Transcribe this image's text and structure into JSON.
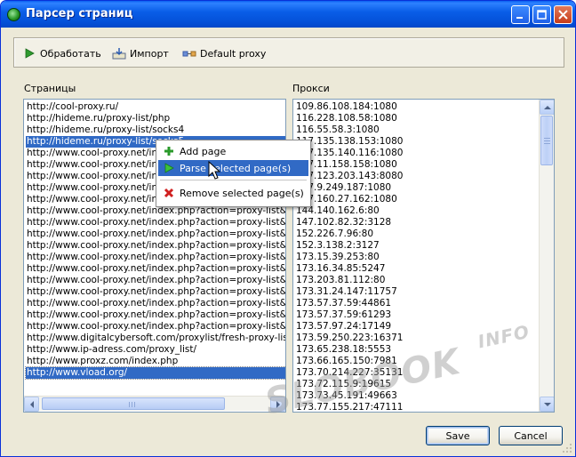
{
  "window": {
    "title": "Парсер страниц"
  },
  "toolbar": {
    "process_label": "Обработать",
    "import_label": "Импорт",
    "proxy_label": "Default proxy"
  },
  "pages": {
    "label": "Страницы",
    "items": [
      "http://cool-proxy.ru/",
      "http://hideme.ru/proxy-list/php",
      "http://hideme.ru/proxy-list/socks4",
      "http://hideme.ru/proxy-list/socks5",
      "http://www.cool-proxy.net/index.php?action=proxy-list&page=1",
      "http://www.cool-proxy.net/index.php?action=proxy-list&page=2",
      "http://www.cool-proxy.net/index.php?action=proxy-list&page=3",
      "http://www.cool-proxy.net/index.php?action=proxy-list&page=4",
      "http://www.cool-proxy.net/index.php?action=proxy-list&page=5",
      "http://www.cool-proxy.net/index.php?action=proxy-list&pa",
      "http://www.cool-proxy.net/index.php?action=proxy-list&pa",
      "http://www.cool-proxy.net/index.php?action=proxy-list&pa",
      "http://www.cool-proxy.net/index.php?action=proxy-list&pa",
      "http://www.cool-proxy.net/index.php?action=proxy-list&pa",
      "http://www.cool-proxy.net/index.php?action=proxy-list&pa",
      "http://www.cool-proxy.net/index.php?action=proxy-list&pa",
      "http://www.cool-proxy.net/index.php?action=proxy-list&pa",
      "http://www.cool-proxy.net/index.php?action=proxy-list&pa",
      "http://www.cool-proxy.net/index.php?action=proxy-list&pa",
      "http://www.cool-proxy.net/index.php?action=proxy-list&pa",
      "http://www.digitalcybersoft.com/proxylist/fresh-proxy-list.s",
      "http://www.ip-adress.com/proxy_list/",
      "http://www.proxz.com/index.php",
      "http://www.vload.org/"
    ]
  },
  "proxies": {
    "label": "Прокси",
    "items": [
      "109.86.108.184:1080",
      "116.228.108.58:1080",
      "116.55.58.3:1080",
      "117.135.138.153:1080",
      "117.135.140.116:1080",
      "117.11.158.158:1080",
      "117.123.203.143:8080",
      "117.9.249.187:1080",
      "117.160.27.162:1080",
      "144.140.162.6:80",
      "147.102.82.32:3128",
      "152.226.7.96:80",
      "152.3.138.2:3127",
      "173.15.39.253:80",
      "173.16.34.85:5247",
      "173.203.81.112:80",
      "173.31.24.147:11757",
      "173.57.37.59:44861",
      "173.57.37.59:61293",
      "173.57.97.24:17149",
      "173.59.250.223:16371",
      "173.65.238.18:5553",
      "173.66.165.150:7981",
      "173.70.214.227:35131",
      "173.72.115.9:19615",
      "173.73.45.191:49663",
      "173.77.155.217:47111"
    ]
  },
  "context_menu": {
    "add": "Add page",
    "parse": "Parse selected page(s)",
    "remove": "Remove selected page(s)"
  },
  "buttons": {
    "save": "Save",
    "cancel": "Cancel"
  },
  "watermark": {
    "main": "SLOBOOK",
    "sup": "INFO"
  }
}
